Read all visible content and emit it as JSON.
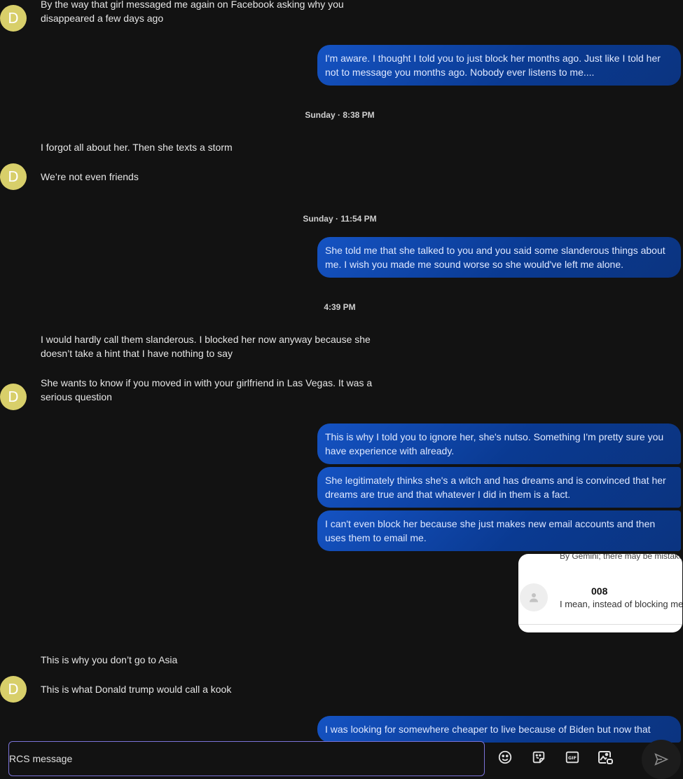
{
  "contact": {
    "avatar_letter": "D"
  },
  "messages": {
    "m1": "By the way that girl messaged me again on Facebook asking why you disappeared a few days ago",
    "m2": "I'm aware. I thought I told you to just block her months ago. Just like I told her not to message you months ago. Nobody ever listens to me....",
    "ts1": "Sunday · 8:38 PM",
    "m3": "I forgot all about her. Then she texts a storm",
    "m4": "We’re not even friends",
    "ts2": "Sunday · 11:54 PM",
    "m5": "She told me that she talked to you and you said some slanderous things about me. I wish you made me sound worse so she would've left me alone.",
    "ts3": "4:39 PM",
    "m6": "I would hardly call them slanderous. I blocked her now anyway because she doesn’t take a hint that I have nothing to say",
    "m7": "She wants to know if you moved in with your girlfriend in Las Vegas. It was a serious question",
    "m8": "This is why I told you to ignore her, she's nutso. Something I'm pretty sure you have experience with already.",
    "m9": "She legitimately thinks she's a witch and has dreams and is convinced that her dreams are true and that whatever I did in them is a fact.",
    "m10": "I can't even block her because she just makes new email accounts and then uses them to email me.",
    "m11": "This is why you don’t go to Asia",
    "m12": "This is what Donald trump would call a kook",
    "m13": "I was looking for somewhere cheaper to live because of Biden but now that"
  },
  "gemini_card": {
    "disclaimer": "By Gemini; there may be mistakes",
    "name": "008",
    "preview": "I mean, instead of blocking me"
  },
  "composer": {
    "placeholder": "RCS message",
    "value": "",
    "icons": [
      "emoji-icon",
      "sticker-icon",
      "gif-icon",
      "attach-media-icon",
      "send-icon"
    ]
  }
}
